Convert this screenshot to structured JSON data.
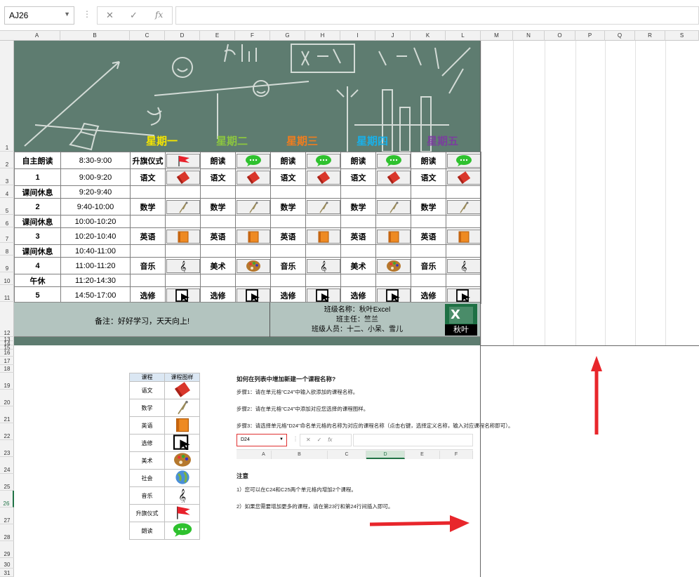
{
  "formula_bar": {
    "name_box": "AJ26",
    "fx": "fx",
    "cancel": "✕",
    "enter": "✓"
  },
  "columns": [
    "A",
    "B",
    "C",
    "D",
    "E",
    "F",
    "G",
    "H",
    "I",
    "J",
    "K",
    "L",
    "M",
    "N",
    "O",
    "P",
    "Q",
    "R",
    "S"
  ],
  "rows": [
    "1",
    "2",
    "3",
    "4",
    "5",
    "6",
    "7",
    "8",
    "9",
    "10",
    "11",
    "12",
    "13",
    "14",
    "15",
    "16",
    "17",
    "18",
    "19",
    "20",
    "21",
    "22",
    "23",
    "24",
    "25",
    "26",
    "27",
    "28",
    "29",
    "30",
    "31"
  ],
  "banner": {
    "days": [
      {
        "label": "星期一",
        "color": "#f5e500"
      },
      {
        "label": "星期二",
        "color": "#8cc63f"
      },
      {
        "label": "星期三",
        "color": "#f07d1e"
      },
      {
        "label": "星期四",
        "color": "#19b0e8"
      },
      {
        "label": "星期五",
        "color": "#7a3f9d"
      }
    ]
  },
  "schedule": [
    {
      "period": "自主朗读",
      "time": "8:30-9:00",
      "cells": [
        {
          "t": "升旗仪式",
          "i": "flag-icon"
        },
        {
          "t": "朗读",
          "i": "speech-bubble-icon"
        },
        {
          "t": "朗读",
          "i": "speech-bubble-icon"
        },
        {
          "t": "朗读",
          "i": "speech-bubble-icon"
        },
        {
          "t": "朗读",
          "i": "speech-bubble-icon"
        }
      ]
    },
    {
      "period": "1",
      "time": "9:00-9:20",
      "cells": [
        {
          "t": "语文",
          "i": "book-red-icon"
        },
        {
          "t": "语文",
          "i": "book-red-icon"
        },
        {
          "t": "语文",
          "i": "book-red-icon"
        },
        {
          "t": "语文",
          "i": "book-red-icon"
        },
        {
          "t": "语文",
          "i": "book-red-icon"
        }
      ]
    },
    {
      "period": "课间休息",
      "time": "9:20-9:40",
      "cells": []
    },
    {
      "period": "2",
      "time": "9:40-10:00",
      "cells": [
        {
          "t": "数学",
          "i": "compass-icon"
        },
        {
          "t": "数学",
          "i": "compass-icon"
        },
        {
          "t": "数学",
          "i": "compass-icon"
        },
        {
          "t": "数学",
          "i": "compass-icon"
        },
        {
          "t": "数学",
          "i": "compass-icon"
        }
      ]
    },
    {
      "period": "课间休息",
      "time": "10:00-10:20",
      "cells": []
    },
    {
      "period": "3",
      "time": "10:20-10:40",
      "cells": [
        {
          "t": "英语",
          "i": "book-orange-icon"
        },
        {
          "t": "英语",
          "i": "book-orange-icon"
        },
        {
          "t": "英语",
          "i": "book-orange-icon"
        },
        {
          "t": "英语",
          "i": "book-orange-icon"
        },
        {
          "t": "英语",
          "i": "book-orange-icon"
        }
      ]
    },
    {
      "period": "课间休息",
      "time": "10:40-11:00",
      "cells": []
    },
    {
      "period": "4",
      "time": "11:00-11:20",
      "cells": [
        {
          "t": "音乐",
          "i": "treble-clef-icon"
        },
        {
          "t": "美术",
          "i": "palette-icon"
        },
        {
          "t": "音乐",
          "i": "treble-clef-icon"
        },
        {
          "t": "美术",
          "i": "palette-icon"
        },
        {
          "t": "音乐",
          "i": "treble-clef-icon"
        }
      ]
    },
    {
      "period": "午休",
      "time": "11:20-14:30",
      "cells": []
    },
    {
      "period": "5",
      "time": "14:50-17:00",
      "cells": [
        {
          "t": "选修",
          "i": "cursor-icon"
        },
        {
          "t": "选修",
          "i": "cursor-icon"
        },
        {
          "t": "选修",
          "i": "cursor-icon"
        },
        {
          "t": "选修",
          "i": "cursor-icon"
        },
        {
          "t": "选修",
          "i": "cursor-icon"
        }
      ]
    }
  ],
  "footer": {
    "note": "备注：好好学习，天天向上!",
    "class_name": "班级名称：秋叶Excel",
    "teacher": "班主任：竺兰",
    "members": "班级人员：十二、小呆、雪儿",
    "logo_text": "秋叶"
  },
  "course_table": {
    "headers": [
      "课程",
      "课程图样"
    ],
    "rows": [
      {
        "name": "语文",
        "i": "book-red-icon"
      },
      {
        "name": "数学",
        "i": "compass-icon"
      },
      {
        "name": "英语",
        "i": "book-orange-icon"
      },
      {
        "name": "选修",
        "i": "cursor-icon"
      },
      {
        "name": "美术",
        "i": "palette-icon"
      },
      {
        "name": "社会",
        "i": "globe-icon"
      },
      {
        "name": "音乐",
        "i": "treble-clef-icon"
      },
      {
        "name": "升旗仪式",
        "i": "flag-icon"
      },
      {
        "name": "朗读",
        "i": "speech-bubble-icon"
      }
    ]
  },
  "instructions": {
    "title": "如何在列表中增加新建一个课程名称?",
    "step1": "步骤1：请在单元格\"C24\"中输入欲添加的课程名称。",
    "step2": "步骤2：请在单元格\"C24\"中添加对应您选择的课程图样。",
    "step3": "步骤3：请选择单元格\"D24\"命名单元格的名称为对应的课程名称（点击右键，选择定义名称，输入对应课程名称即可）。",
    "mini_namebox": "D24",
    "mini_cols": [
      "A",
      "B",
      "C",
      "D",
      "E",
      "F"
    ],
    "note_title": "注意",
    "note1": "1）您可以在C24和C25两个单元格内增加2个课程。",
    "note2": "2）如果您需要增加更多的课程，请在第23行和第24行间插入即可。"
  }
}
